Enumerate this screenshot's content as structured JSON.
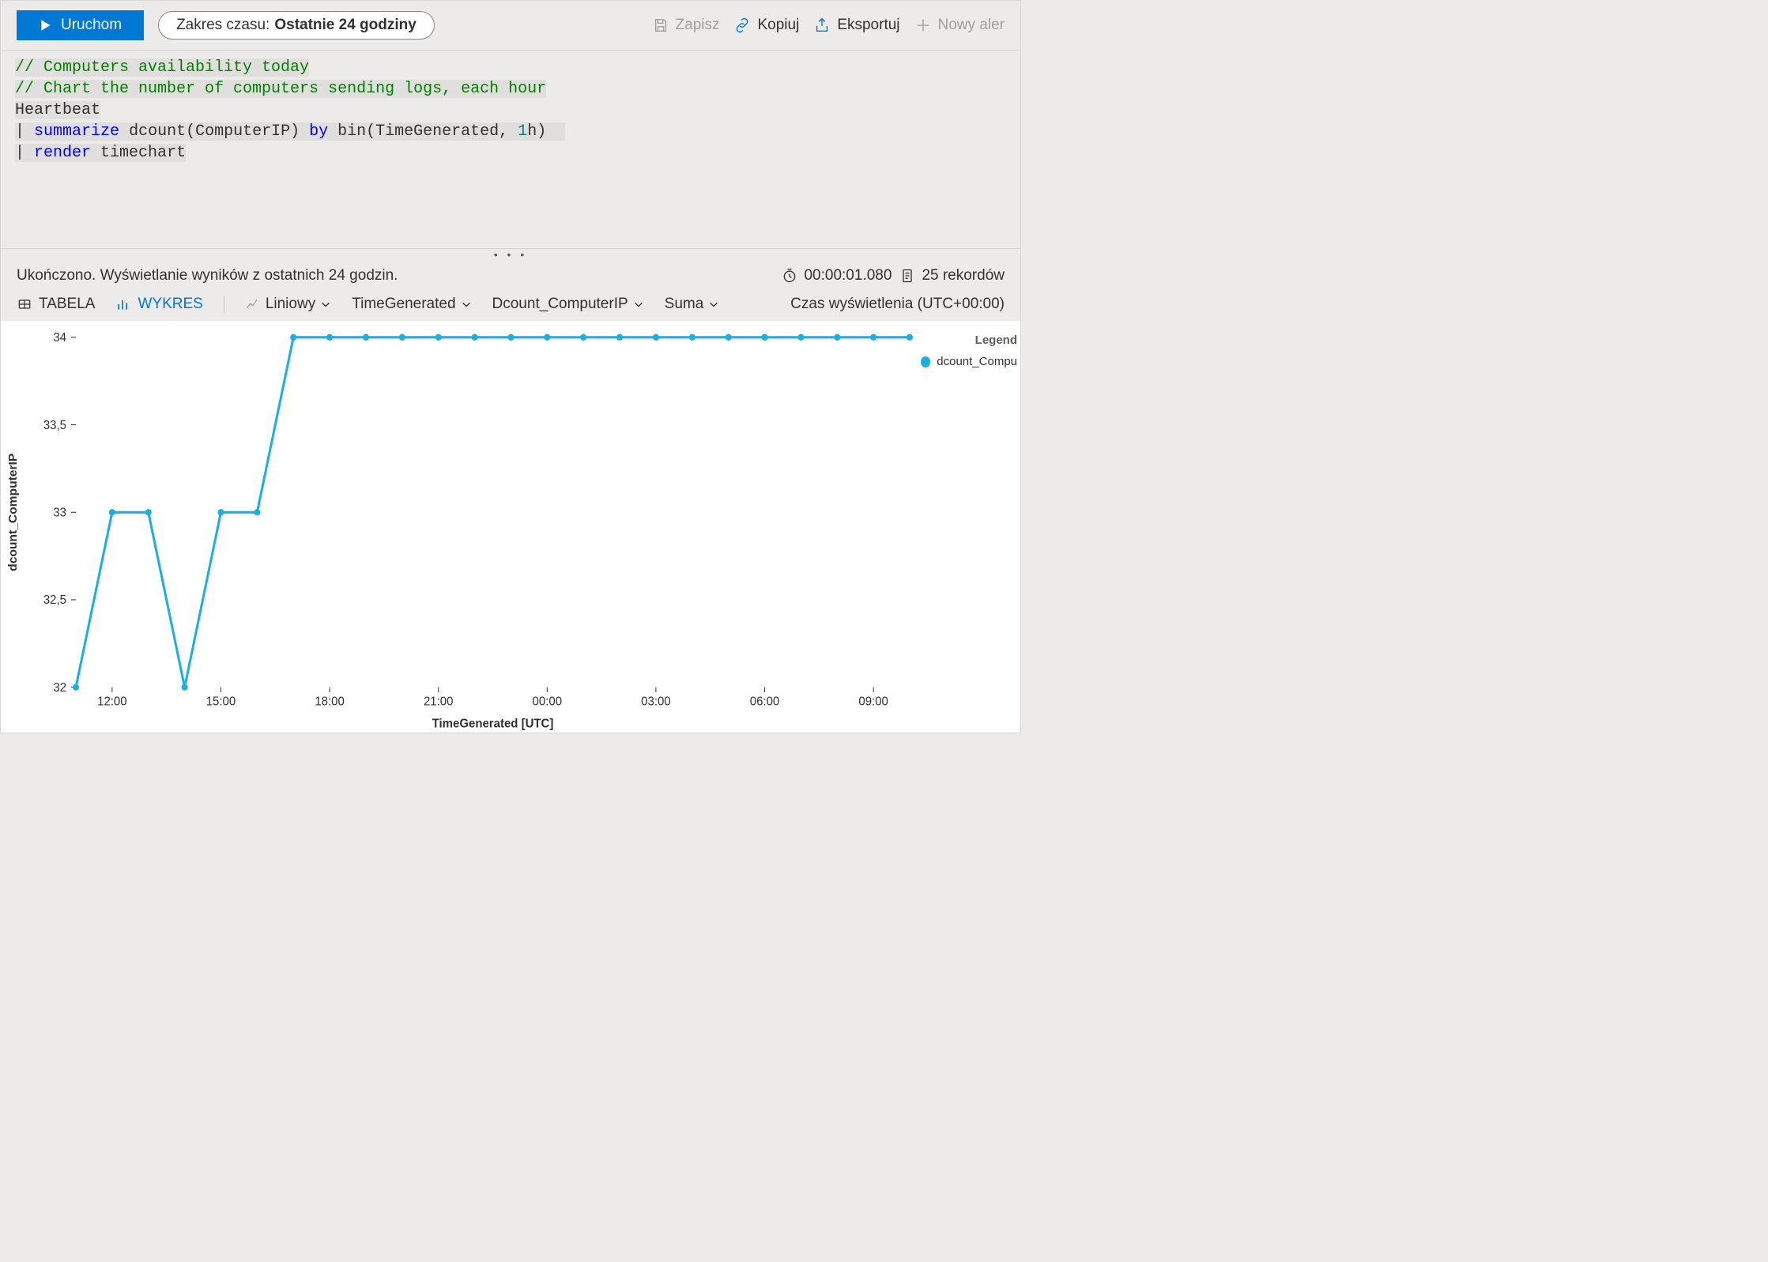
{
  "toolbar": {
    "run_label": "Uruchom",
    "time_range_prefix": "Zakres czasu:",
    "time_range_value": "Ostatnie 24 godziny",
    "save_label": "Zapisz",
    "copy_label": "Kopiuj",
    "export_label": "Eksportuj",
    "new_alert_label": "Nowy aler"
  },
  "editor": {
    "line1_comment": "// Computers availability today",
    "line2_comment": "// Chart the number of computers sending logs, each hour",
    "line3_table": "Heartbeat",
    "line4_pipe": "|",
    "line4_kw": "summarize",
    "line4_rest_a": " dcount(ComputerIP) ",
    "line4_kw2": "by",
    "line4_rest_b": " bin(TimeGenerated, ",
    "line4_lit": "1",
    "line4_rest_c": "h)",
    "line5_pipe": "|",
    "line5_kw": "render",
    "line5_rest": " timechart"
  },
  "results": {
    "status_text": "Ukończono. Wyświetlanie wyników z ostatnich 24 godzin.",
    "duration": "00:00:01.080",
    "records": "25 rekordów",
    "tab_table": "TABELA",
    "tab_chart": "WYKRES",
    "chart_type": "Liniowy",
    "x_col": "TimeGenerated",
    "y_col": "Dcount_ComputerIP",
    "agg": "Suma",
    "tz_label": "Czas wyświetlenia (UTC+00:00)"
  },
  "legend": {
    "title": "Legend",
    "series1": "dcount_Compu"
  },
  "chart_data": {
    "type": "line",
    "title": "",
    "xlabel": "TimeGenerated [UTC]",
    "ylabel": "dcount_ComputerIP",
    "ylim": [
      32,
      34
    ],
    "y_ticks": [
      32,
      32.5,
      33,
      33.5,
      34
    ],
    "y_tick_labels": [
      "32",
      "32,5",
      "33",
      "33,5",
      "34"
    ],
    "x_tick_pos": [
      12,
      15,
      18,
      21,
      24,
      27,
      30,
      33
    ],
    "x_tick_labels": [
      "12:00",
      "15:00",
      "18:00",
      "21:00",
      "00:00",
      "03:00",
      "06:00",
      "09:00"
    ],
    "series": [
      {
        "name": "dcount_ComputerIP",
        "color": "#1aaee5",
        "x": [
          11,
          12,
          13,
          14,
          15,
          16,
          17,
          18,
          19,
          20,
          21,
          22,
          23,
          24,
          25,
          26,
          27,
          28,
          29,
          30,
          31,
          32,
          33,
          34
        ],
        "values": [
          32,
          33,
          33,
          32,
          33,
          33,
          34,
          34,
          34,
          34,
          34,
          34,
          34,
          34,
          34,
          34,
          34,
          34,
          34,
          34,
          34,
          34,
          34,
          34
        ]
      }
    ]
  }
}
